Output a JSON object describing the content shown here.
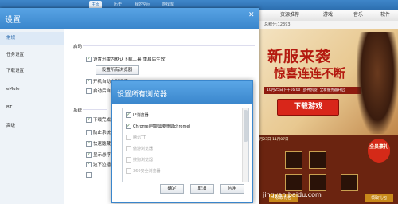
{
  "background_app": {
    "tabs": [
      "主页",
      "历史",
      "我的空间",
      "游戏库"
    ],
    "nav": [
      "资源推荐",
      "游戏",
      "音乐",
      "软件"
    ],
    "status": "总积分:12393",
    "ad": {
      "title": "新服来袭",
      "subtitle": "惊喜连连不断",
      "date_line": "10月25日下午16:00 [战神凯旋] 全新服务器开启",
      "download_label": "下载游戏",
      "date_line2": "10月23日-11月07日",
      "badge_label": "全员豪礼",
      "lower_buttons": [
        "领取礼包",
        "领取礼包"
      ]
    },
    "watermark": "jingyan.baidu.com"
  },
  "settings": {
    "title": "设置",
    "close_label": "✕",
    "sidebar": [
      "常规",
      "任务设置",
      "下载设置",
      "eMule",
      "BT",
      "高级"
    ],
    "startup_section": "启动",
    "system_section": "系统",
    "startup_options": [
      {
        "label": "设置迅雷为默认下载工具(重启后生效)",
        "checked": true
      },
      {
        "label": "开机自动启动迅雷",
        "checked": true
      },
      {
        "label": "启动后自动...",
        "checked": false
      }
    ],
    "browsers_button": "设置所有浏览器",
    "system_options": [
      {
        "label": "下载完成...",
        "checked": true
      },
      {
        "label": "防止系统...",
        "checked": false
      },
      {
        "label": "快速隐藏...",
        "checked": true
      },
      {
        "label": "显示悬浮...",
        "checked": true
      },
      {
        "label": "边下边播...",
        "checked": true
      },
      {
        "label": "",
        "checked": false
      }
    ]
  },
  "dialog": {
    "title": "设置所有浏览器",
    "browsers": [
      {
        "label": "IE浏览器",
        "checked": true,
        "enabled": true
      },
      {
        "label": "Chrome(可能需要重启chrome)",
        "checked": true,
        "enabled": true
      },
      {
        "label": "腾讯TT",
        "checked": false,
        "enabled": false
      },
      {
        "label": "傲游浏览器",
        "checked": false,
        "enabled": false
      },
      {
        "label": "搜狗浏览器",
        "checked": false,
        "enabled": false
      },
      {
        "label": "360安全浏览器",
        "checked": false,
        "enabled": false
      }
    ],
    "ok_label": "确定",
    "cancel_label": "取消",
    "apply_label": "应用"
  }
}
